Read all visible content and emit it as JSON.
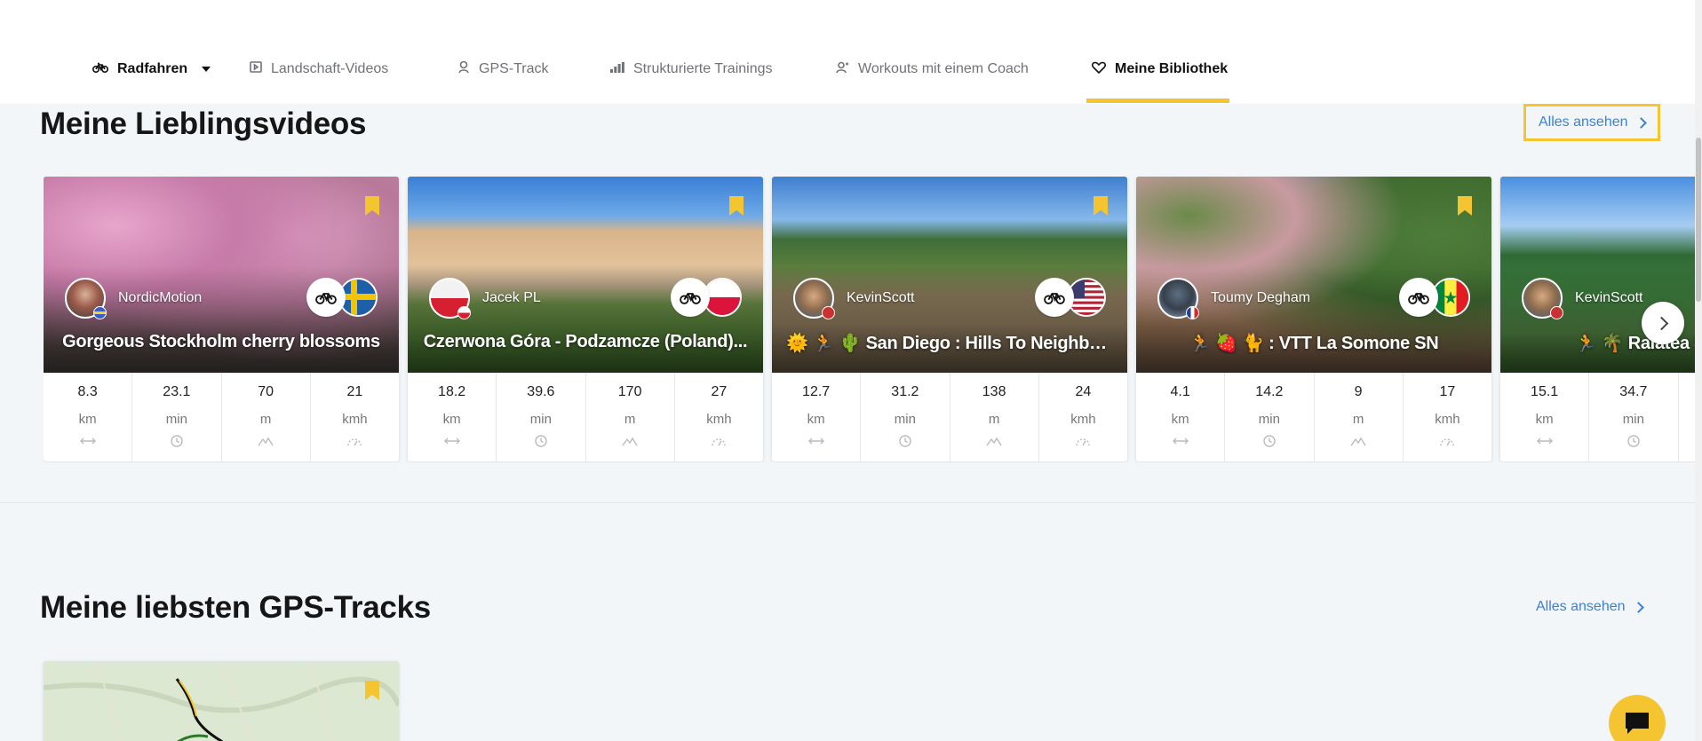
{
  "nav": {
    "sport_label": "Radfahren",
    "items": [
      {
        "label": "Landschaft-Videos",
        "icon": "play-square-icon"
      },
      {
        "label": "GPS-Track",
        "icon": "map-pin-icon"
      },
      {
        "label": "Strukturierte Trainings",
        "icon": "bar-chart-icon"
      },
      {
        "label": "Workouts mit einem Coach",
        "icon": "coach-icon"
      },
      {
        "label": "Meine Bibliothek",
        "icon": "heart-icon",
        "active": true
      }
    ]
  },
  "favorites": {
    "title": "Meine Lieblingsvideos",
    "see_all": "Alles ansehen",
    "cards": [
      {
        "author": "NordicMotion",
        "title": "Gorgeous Stockholm cherry blossoms",
        "flag": "sweden-flag-icon",
        "stats": [
          {
            "v": "8.3",
            "u": "km"
          },
          {
            "v": "23.1",
            "u": "min"
          },
          {
            "v": "70",
            "u": "m"
          },
          {
            "v": "21",
            "u": "kmh"
          }
        ]
      },
      {
        "author": "Jacek PL",
        "title": "Czerwona Góra - Podzamcze (Poland)...",
        "flag": "poland-flag-icon",
        "stats": [
          {
            "v": "18.2",
            "u": "km"
          },
          {
            "v": "39.6",
            "u": "min"
          },
          {
            "v": "170",
            "u": "m"
          },
          {
            "v": "27",
            "u": "kmh"
          }
        ]
      },
      {
        "author": "KevinScott",
        "title": "🌞 🏃 🌵 San Diego : Hills To Neighborh...",
        "flag": "usa-flag-icon",
        "stats": [
          {
            "v": "12.7",
            "u": "km"
          },
          {
            "v": "31.2",
            "u": "min"
          },
          {
            "v": "138",
            "u": "m"
          },
          {
            "v": "24",
            "u": "kmh"
          }
        ]
      },
      {
        "author": "Toumy Degham",
        "title": "🏃 🍓 🐈 : VTT La Somone SN",
        "flag": "senegal-flag-icon",
        "stats": [
          {
            "v": "4.1",
            "u": "km"
          },
          {
            "v": "14.2",
            "u": "min"
          },
          {
            "v": "9",
            "u": "m"
          },
          {
            "v": "17",
            "u": "kmh"
          }
        ]
      },
      {
        "author": "KevinScott",
        "title": "🏃 🌴 Raiatea S",
        "flag": "usa-flag-icon",
        "stats": [
          {
            "v": "15.1",
            "u": "km"
          },
          {
            "v": "34.7",
            "u": "min"
          },
          {
            "v": "",
            "u": ""
          },
          {
            "v": "",
            "u": ""
          }
        ]
      }
    ]
  },
  "gps": {
    "title": "Meine liebsten GPS-Tracks",
    "see_all": "Alles ansehen"
  }
}
